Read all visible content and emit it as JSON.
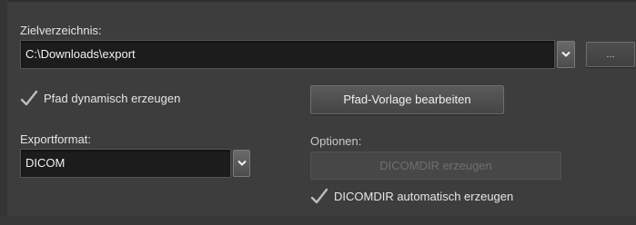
{
  "target_dir": {
    "label": "Zielverzeichnis:",
    "value": "C:\\Downloads\\export",
    "browse_label": "..."
  },
  "dynamic_path": {
    "label": "Pfad dynamisch erzeugen",
    "checked": true
  },
  "path_template_button": "Pfad-Vorlage bearbeiten",
  "export_format": {
    "label": "Exportformat:",
    "value": "DICOM"
  },
  "options": {
    "label": "Optionen:",
    "dicomdir_button": "DICOMDIR erzeugen",
    "dicomdir_auto_label": "DICOMDIR automatisch erzeugen",
    "dicomdir_auto_checked": true
  }
}
